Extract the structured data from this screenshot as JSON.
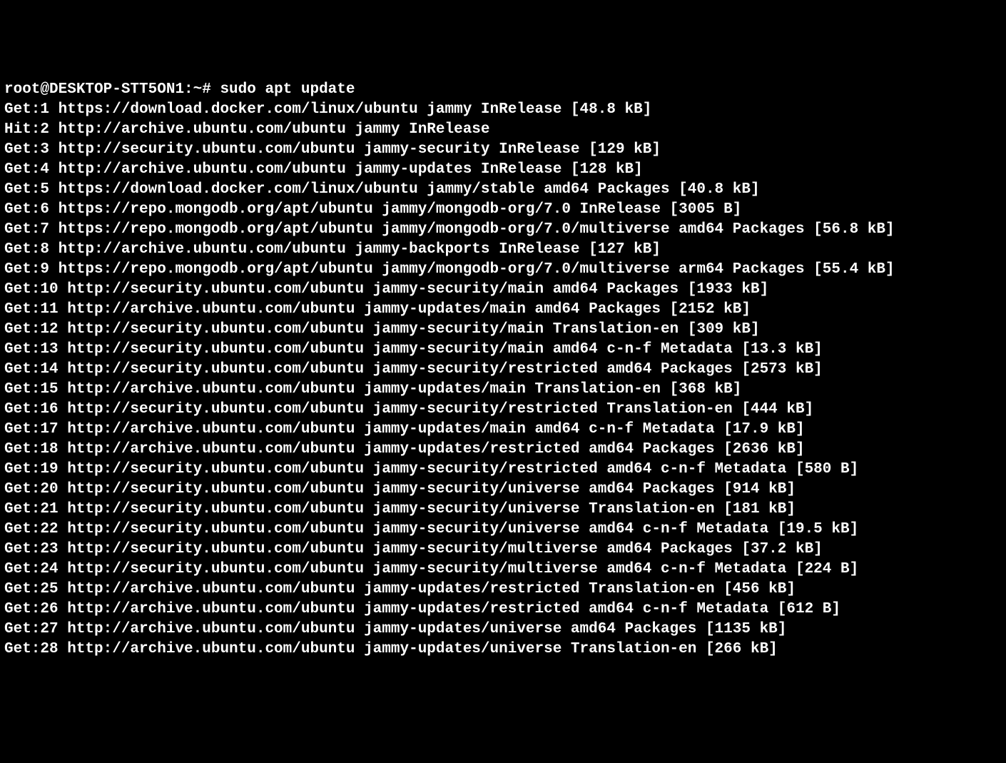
{
  "prompt": "root@DESKTOP-STT5ON1:~# ",
  "command": "sudo apt update",
  "lines": [
    "Get:1 https://download.docker.com/linux/ubuntu jammy InRelease [48.8 kB]",
    "Hit:2 http://archive.ubuntu.com/ubuntu jammy InRelease",
    "Get:3 http://security.ubuntu.com/ubuntu jammy-security InRelease [129 kB]",
    "Get:4 http://archive.ubuntu.com/ubuntu jammy-updates InRelease [128 kB]",
    "Get:5 https://download.docker.com/linux/ubuntu jammy/stable amd64 Packages [40.8 kB]",
    "Get:6 https://repo.mongodb.org/apt/ubuntu jammy/mongodb-org/7.0 InRelease [3005 B]",
    "Get:7 https://repo.mongodb.org/apt/ubuntu jammy/mongodb-org/7.0/multiverse amd64 Packages [56.8 kB]",
    "Get:8 http://archive.ubuntu.com/ubuntu jammy-backports InRelease [127 kB]",
    "Get:9 https://repo.mongodb.org/apt/ubuntu jammy/mongodb-org/7.0/multiverse arm64 Packages [55.4 kB]",
    "Get:10 http://security.ubuntu.com/ubuntu jammy-security/main amd64 Packages [1933 kB]",
    "Get:11 http://archive.ubuntu.com/ubuntu jammy-updates/main amd64 Packages [2152 kB]",
    "Get:12 http://security.ubuntu.com/ubuntu jammy-security/main Translation-en [309 kB]",
    "Get:13 http://security.ubuntu.com/ubuntu jammy-security/main amd64 c-n-f Metadata [13.3 kB]",
    "Get:14 http://security.ubuntu.com/ubuntu jammy-security/restricted amd64 Packages [2573 kB]",
    "Get:15 http://archive.ubuntu.com/ubuntu jammy-updates/main Translation-en [368 kB]",
    "Get:16 http://security.ubuntu.com/ubuntu jammy-security/restricted Translation-en [444 kB]",
    "Get:17 http://archive.ubuntu.com/ubuntu jammy-updates/main amd64 c-n-f Metadata [17.9 kB]",
    "Get:18 http://archive.ubuntu.com/ubuntu jammy-updates/restricted amd64 Packages [2636 kB]",
    "Get:19 http://security.ubuntu.com/ubuntu jammy-security/restricted amd64 c-n-f Metadata [580 B]",
    "Get:20 http://security.ubuntu.com/ubuntu jammy-security/universe amd64 Packages [914 kB]",
    "Get:21 http://security.ubuntu.com/ubuntu jammy-security/universe Translation-en [181 kB]",
    "Get:22 http://security.ubuntu.com/ubuntu jammy-security/universe amd64 c-n-f Metadata [19.5 kB]",
    "Get:23 http://security.ubuntu.com/ubuntu jammy-security/multiverse amd64 Packages [37.2 kB]",
    "Get:24 http://security.ubuntu.com/ubuntu jammy-security/multiverse amd64 c-n-f Metadata [224 B]",
    "Get:25 http://archive.ubuntu.com/ubuntu jammy-updates/restricted Translation-en [456 kB]",
    "Get:26 http://archive.ubuntu.com/ubuntu jammy-updates/restricted amd64 c-n-f Metadata [612 B]",
    "Get:27 http://archive.ubuntu.com/ubuntu jammy-updates/universe amd64 Packages [1135 kB]",
    "Get:28 http://archive.ubuntu.com/ubuntu jammy-updates/universe Translation-en [266 kB]"
  ]
}
